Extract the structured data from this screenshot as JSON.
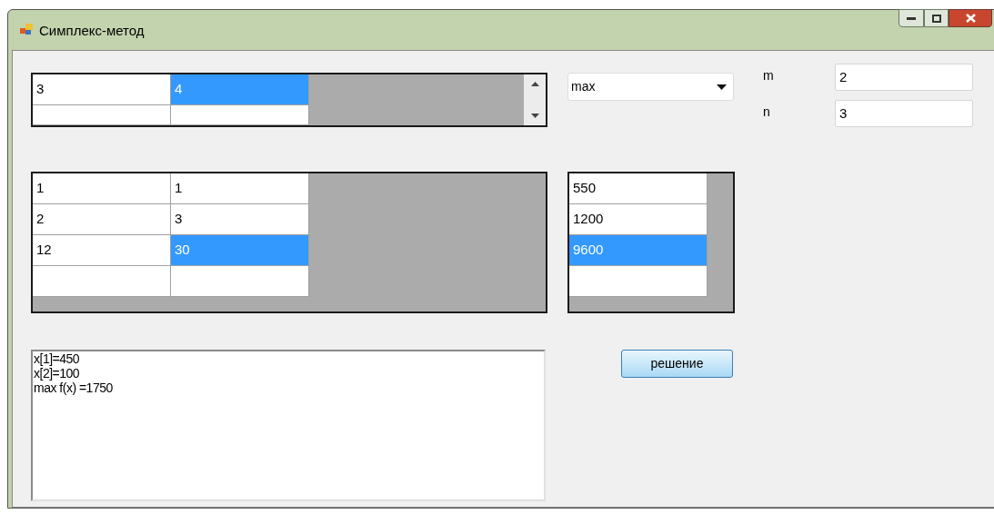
{
  "window": {
    "title": "Симплекс-метод"
  },
  "objective_grid": {
    "rows": [
      {
        "cells": [
          {
            "value": "3",
            "selected": false
          },
          {
            "value": "4",
            "selected": true
          }
        ]
      },
      {
        "cells": [
          {
            "selected": false
          },
          {
            "selected": false
          }
        ]
      }
    ]
  },
  "goal_combo": {
    "value": "max"
  },
  "params": [
    {
      "label": "m",
      "value": "2"
    },
    {
      "label": "n",
      "value": "3"
    }
  ],
  "constraint_grid": {
    "rows": [
      {
        "cells": [
          {
            "value": "1",
            "selected": false
          },
          {
            "value": "1",
            "selected": false
          }
        ]
      },
      {
        "cells": [
          {
            "value": "2",
            "selected": false
          },
          {
            "value": "3",
            "selected": false
          }
        ]
      },
      {
        "cells": [
          {
            "value": "12",
            "selected": false
          },
          {
            "value": "30",
            "selected": true
          }
        ]
      },
      {
        "cells": [
          {
            "selected": false
          },
          {
            "selected": false
          }
        ]
      }
    ]
  },
  "rhs_grid": {
    "rows": [
      {
        "cells": [
          {
            "value": "550",
            "selected": false
          }
        ]
      },
      {
        "cells": [
          {
            "value": "1200",
            "selected": false
          }
        ]
      },
      {
        "cells": [
          {
            "value": "9600",
            "selected": true
          }
        ]
      },
      {
        "cells": [
          {
            "selected": false
          }
        ]
      }
    ]
  },
  "result_box": {
    "lines": [
      "x[1]=450",
      "x[2]=100",
      "max f(x) =1750"
    ]
  },
  "solve_button": {
    "label": "решение"
  }
}
